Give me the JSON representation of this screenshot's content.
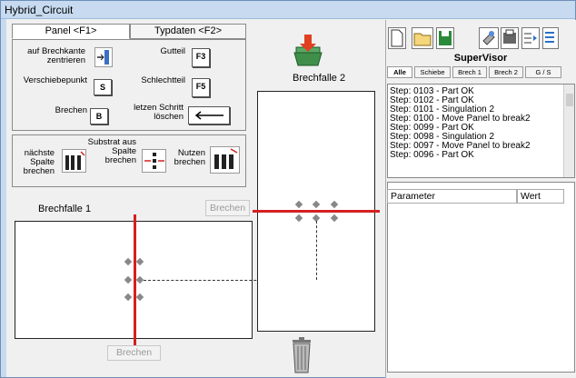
{
  "window": {
    "title": "Hybrid_Circuit"
  },
  "tabs": [
    {
      "label": "Panel <F1>"
    },
    {
      "label": "Typdaten <F2>"
    }
  ],
  "controls": {
    "center_label": "auf Brechkante\nzentrieren",
    "move_label": "Verschiebepunkt",
    "move_key": "S",
    "break_label": "Brechen",
    "break_key": "B",
    "good_label": "Gutteil",
    "good_key": "F3",
    "bad_label": "Schlechtteil",
    "bad_key": "F5",
    "undo_label": "letzen Schritt\nlöschen",
    "next_col_label": "nächste\nSpalte\nbrechen",
    "substrate_label": "Substrat aus\nSpalte\nbrechen",
    "panel_label": "Nutzen\nbrechen"
  },
  "left_area": {
    "title": "Brechfalle 1",
    "top_button": "Brechen",
    "bottom_button": "Brechen"
  },
  "center_area": {
    "title": "Brechfalle 2"
  },
  "supervisor": {
    "title": "SuperVisor",
    "tabs": [
      "Alle",
      "Schiebe",
      "Brech 1",
      "Brech 2",
      "G / S"
    ],
    "log": [
      "Step: 0103 - Part OK",
      "Step: 0102 - Part OK",
      "Step: 0101 - Singulation 2",
      "Step: 0100 - Move Panel to break2",
      "Step: 0099 - Part OK",
      "Step: 0098 - Singulation 2",
      "Step: 0097 - Move Panel to break2",
      "Step: 0096 - Part OK"
    ],
    "params_header": "Parameter",
    "value_header": "Wert"
  },
  "icons": [
    "new-file-icon",
    "open-folder-icon",
    "save-icon",
    "tool-icon",
    "print-icon",
    "move-rows-icon",
    "export-icon",
    "download-tray-icon",
    "trash-bin-icon",
    "align-center-icon",
    "undo-arrow-icon",
    "dot-matrix-icon"
  ],
  "colors": {
    "break_line": "#d42020",
    "title_bar": "#c7daf0",
    "tray_green": "#3f8f4a",
    "tray_arrow": "#e04020"
  }
}
